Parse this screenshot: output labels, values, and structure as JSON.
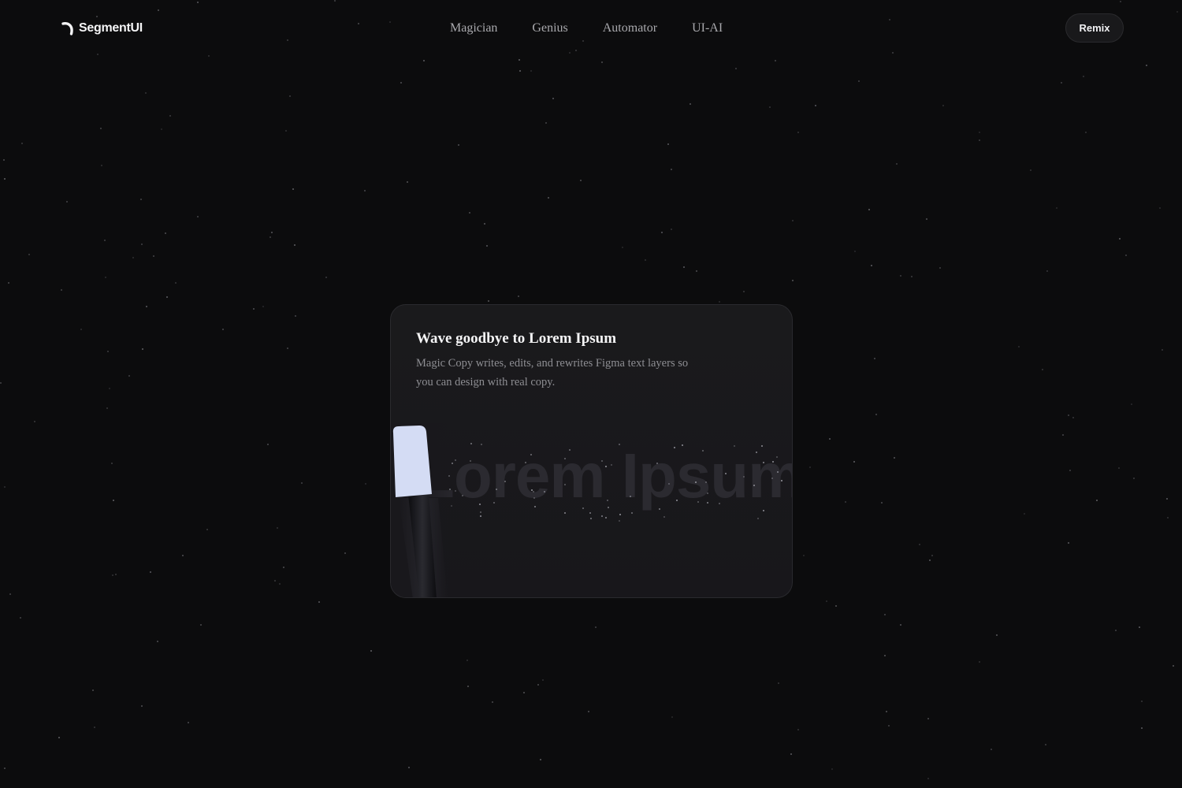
{
  "header": {
    "logo_text": "SegmentUI",
    "nav": [
      {
        "label": "Magician"
      },
      {
        "label": "Genius"
      },
      {
        "label": "Automator"
      },
      {
        "label": "UI-AI"
      }
    ],
    "cta_label": "Remix"
  },
  "card": {
    "title": "Wave goodbye to Lorem Ipsum",
    "description": "Magic Copy writes, edits, and rewrites Figma text layers so you can design with real copy.",
    "visual_text": "Lorem Ipsum"
  },
  "colors": {
    "background": "#0c0c0d",
    "card_background": "#1a1a1c",
    "wand_tip": "#d4dcf4"
  },
  "icons": {
    "logo": "segmentui-logo-icon",
    "wand": "magic-wand-icon"
  }
}
